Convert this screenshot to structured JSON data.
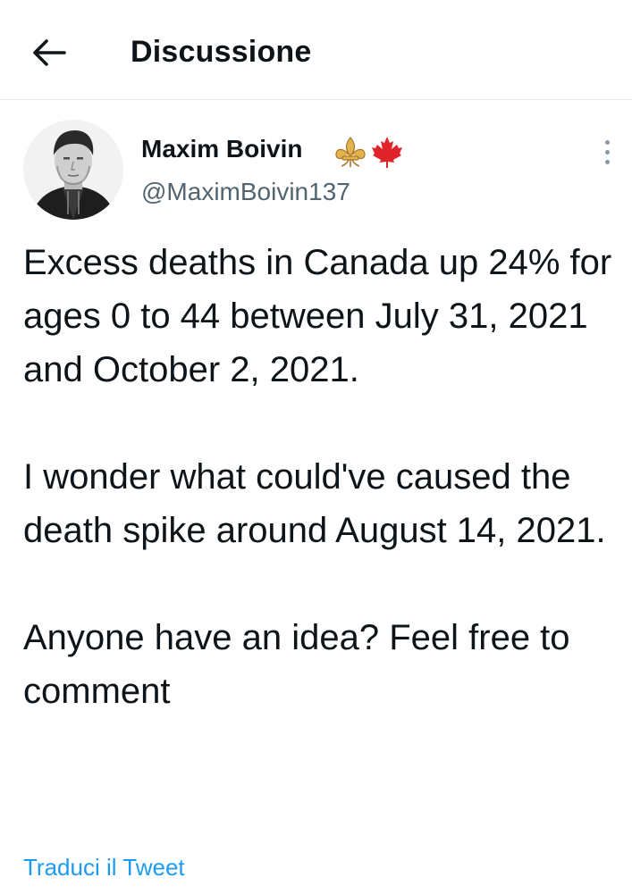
{
  "header": {
    "title": "Discussione",
    "back_icon": "arrow-left-icon"
  },
  "tweet": {
    "author": {
      "name": "Maxim Boivin",
      "handle": "@MaximBoivin137",
      "name_emoji": [
        "fleur-de-lis-icon",
        "maple-leaf-icon"
      ]
    },
    "paragraphs": [
      "Excess deaths in Canada up 24% for ages 0 to 44 between July 31, 2021 and October 2, 2021.",
      "I wonder what could've caused the death spike around August 14, 2021.",
      "Anyone have an idea? Feel free to comment"
    ],
    "translate_label": "Traduci il Tweet"
  },
  "colors": {
    "text": "#0f1419",
    "secondary": "#536471",
    "link": "#1d9bf0",
    "divider": "#e6ecf0",
    "maple": "#e0242b",
    "fleur": "#d9a441"
  }
}
